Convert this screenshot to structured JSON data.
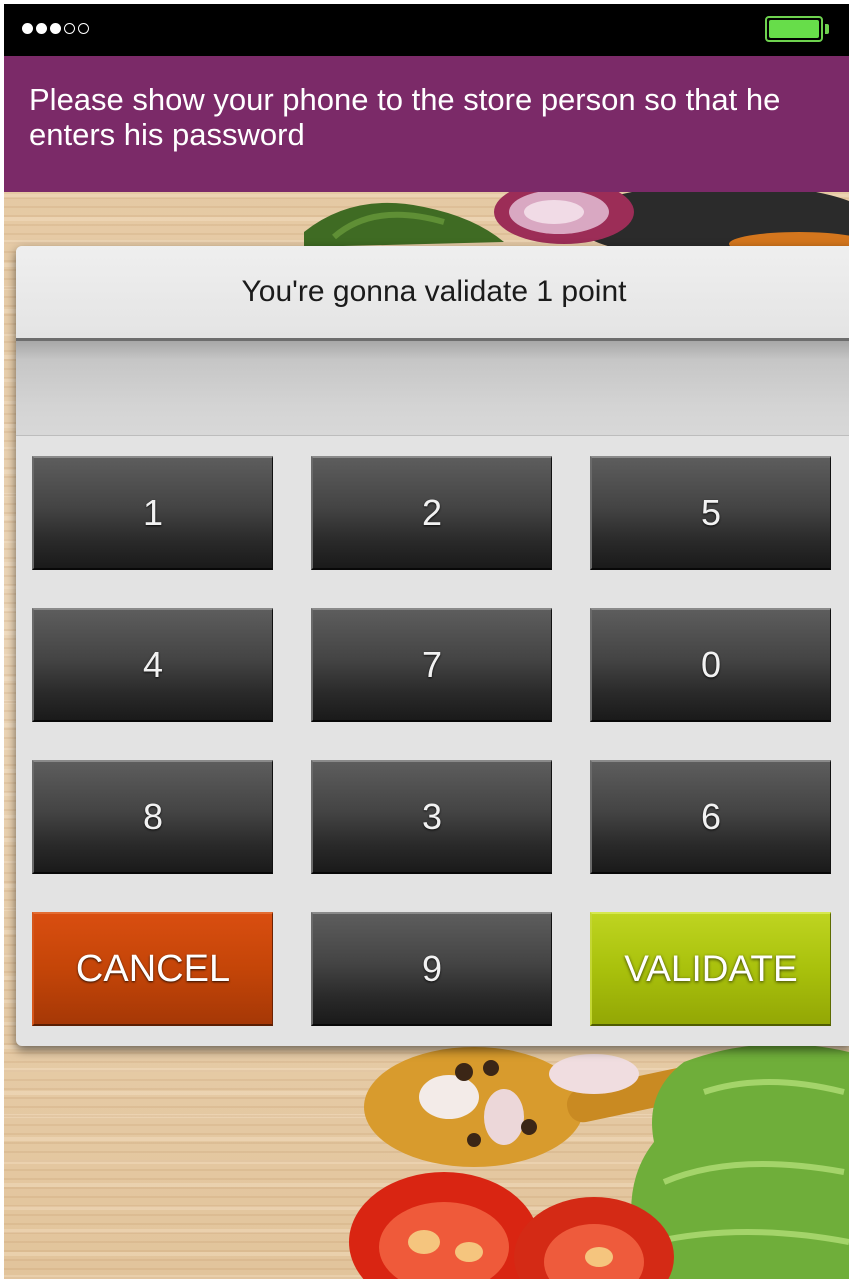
{
  "status_bar": {
    "signal_bars_filled": 3,
    "signal_bars_total": 5,
    "battery_level": 1.0,
    "battery_color": "#67dd4a"
  },
  "header": {
    "message": "Please show your phone to the store person so that he enters his password",
    "background_color": "#7b2a68"
  },
  "dialog": {
    "title": "You're gonna validate 1 point",
    "code_value": "",
    "keys": [
      "1",
      "2",
      "5",
      "4",
      "7",
      "0",
      "8",
      "3",
      "6"
    ],
    "bottom_row": {
      "cancel_label": "CANCEL",
      "key_9": "9",
      "validate_label": "VALIDATE"
    },
    "cancel_color": "#c44508",
    "validate_color": "#a9c10c"
  }
}
